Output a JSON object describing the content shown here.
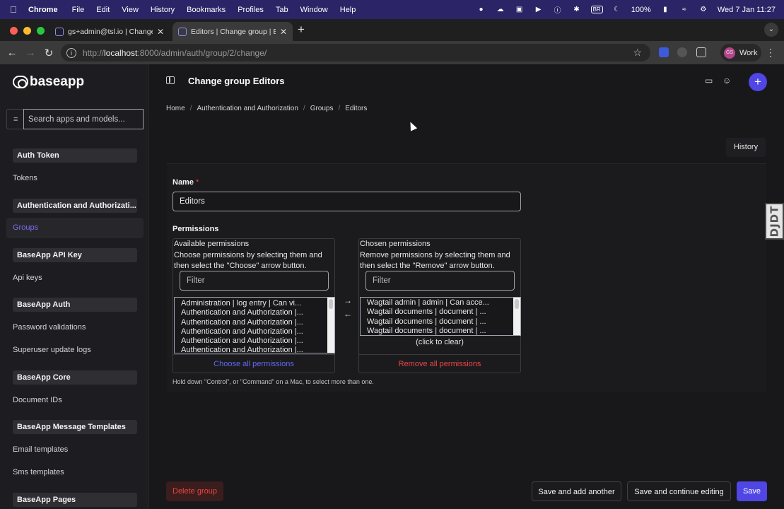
{
  "menubar": {
    "app": "Chrome",
    "items": [
      "File",
      "Edit",
      "View",
      "History",
      "Bookmarks",
      "Profiles",
      "Tab",
      "Window",
      "Help"
    ],
    "keyboard": "BR",
    "battery": "100%",
    "datetime": "Wed 7 Jan  11:27"
  },
  "tabs": [
    {
      "title": "gs+admin@tsl.io | Change us"
    },
    {
      "title": "Editors | Change group | Base"
    }
  ],
  "browser": {
    "url_scheme": "http://",
    "url_host": "localhost",
    "url_path": ":8000/admin/auth/group/2/change/",
    "profile_label": "Work",
    "profile_initials": "GS"
  },
  "sidebar": {
    "brand": "baseapp",
    "search_placeholder": "Search apps and models...",
    "sections": [
      {
        "title": "Auth Token",
        "items": [
          "Tokens"
        ]
      },
      {
        "title": "Authentication and Authorizati...",
        "items": [
          "Groups"
        ]
      },
      {
        "title": "BaseApp API Key",
        "items": [
          "Api keys"
        ]
      },
      {
        "title": "BaseApp Auth",
        "items": [
          "Password validations",
          "Superuser update logs"
        ]
      },
      {
        "title": "BaseApp Core",
        "items": [
          "Document IDs"
        ]
      },
      {
        "title": "BaseApp Message Templates",
        "items": [
          "Email templates",
          "Sms templates"
        ]
      },
      {
        "title": "BaseApp Pages",
        "items": []
      }
    ]
  },
  "header": {
    "title": "Change group Editors"
  },
  "breadcrumbs": [
    "Home",
    "Authentication and Authorization",
    "Groups",
    "Editors"
  ],
  "history_label": "History",
  "form": {
    "name_label": "Name",
    "required_mark": "*",
    "name_value": "Editors",
    "permissions_label": "Permissions",
    "available": {
      "title": "Available permissions",
      "help": "Choose permissions by selecting them and then select the \"Choose\" arrow button.",
      "filter_placeholder": "Filter",
      "options": [
        "Administration  |  log entry  |  Can vi...",
        "Authentication and Authorization  |...",
        "Authentication and Authorization  |...",
        "Authentication and Authorization  |...",
        "Authentication and Authorization  |...",
        "Authentication and Authorization  |..."
      ],
      "footer": "Choose all permissions"
    },
    "chosen": {
      "title": "Chosen permissions",
      "help": "Remove permissions by selecting them and then select the \"Remove\" arrow button.",
      "filter_placeholder": "Filter",
      "options": [
        "Wagtail admin  |  admin  |  Can acce...",
        "Wagtail documents  |  document  |  ...",
        "Wagtail documents  |  document  |  ...",
        "Wagtail documents  |  document  |  ..."
      ],
      "clear_label": "(click to clear)",
      "footer": "Remove all permissions"
    },
    "help_text": "Hold down \"Control\", or \"Command\" on a Mac, to select more than one."
  },
  "actions": {
    "delete": "Delete group",
    "save_add": "Save and add another",
    "save_continue": "Save and continue editing",
    "save": "Save"
  },
  "debug_toolbar": "DJDT",
  "colors": {
    "accent": "#4f46e5",
    "danger": "#ef4444",
    "menubar": "#2b2466"
  }
}
